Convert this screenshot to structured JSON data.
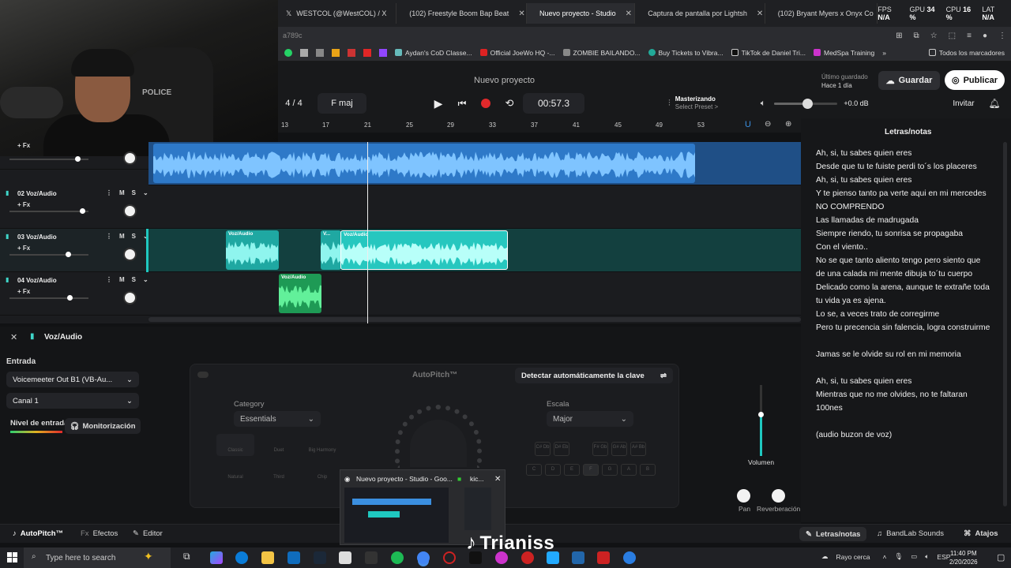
{
  "browser": {
    "tabs": [
      {
        "label": "WESTCOL (@WestCOL) / X",
        "icon": "x-icon"
      },
      {
        "label": "(102) Freestyle Boom Bap Beat",
        "icon": "youtube-icon"
      },
      {
        "label": "Nuevo proyecto - Studio",
        "icon": "bandlab-icon",
        "active": true
      },
      {
        "label": "Captura de pantalla por Lightsh",
        "icon": "feather-icon"
      },
      {
        "label": "(102) Bryant Myers x Onyx Co",
        "icon": "youtube-icon"
      }
    ],
    "stats": {
      "fps_label": "FPS",
      "fps": "N/A",
      "gpu_label": "GPU",
      "gpu": "34 %",
      "cpu_label": "CPU",
      "cpu": "16 %",
      "lat_label": "LAT",
      "lat": "N/A"
    },
    "url_fragment": "a789c",
    "bookmarks": [
      "Aydan's CoD Classe...",
      "Official JoeWo HQ -...",
      "ZOMBIE BAILANDO...",
      "Buy Tickets to Vibra...",
      "TikTok de Daniel Tri...",
      "MedSpa Training"
    ],
    "bookmarks_all": "Todos los marcadores"
  },
  "webcam": {
    "chair_text": "POLICE"
  },
  "header": {
    "project_title": "Nuevo proyecto",
    "saved_label": "Último guardado",
    "saved_time": "Hace 1 día",
    "save_button": "Guardar",
    "publish_button": "Publicar"
  },
  "transport": {
    "time_sig": "4 / 4",
    "key": "F maj",
    "time": "00:57.3",
    "master_label": "Masterizando",
    "master_preset": "Select Preset >",
    "volume_db": "+0.0 dB",
    "invite": "Invitar"
  },
  "ruler": [
    "13",
    "17",
    "21",
    "25",
    "29",
    "33",
    "37",
    "41",
    "45",
    "49",
    "53"
  ],
  "tracks": [
    {
      "name": "",
      "fx": "+ Fx",
      "volume": 0.85
    },
    {
      "name": "02  Voz/Audio",
      "fx": "+ Fx",
      "volume": 0.92
    },
    {
      "name": "03  Voz/Audio",
      "fx": "+ Fx",
      "volume": 0.75
    },
    {
      "name": "04  Voz/Audio",
      "fx": "+ Fx",
      "volume": 0.76
    }
  ],
  "track_buttons": {
    "mute": "M",
    "solo": "S"
  },
  "clips": [
    {
      "label": "Voz/Audio"
    },
    {
      "label": "V..."
    },
    {
      "label": "Voz/Audio"
    },
    {
      "label": "Voz/Audio"
    }
  ],
  "lyrics_panel": {
    "title": "Letras/notas",
    "lines": [
      "Ah, si, tu sabes quien eres",
      "Desde que tu te fuiste perdi to´s los placeres",
      "Ah, si, tu sabes quien eres",
      "Y te pienso tanto pa verte aqui en mi mercedes",
      "NO COMPRENDO",
      "Las llamadas de madrugada",
      "Siempre riendo, tu sonrisa se propagaba",
      "Con el viento..",
      "No se que tanto aliento tengo pero siento que de una calada mi mente dibuja to´tu cuerpo",
      "Delicado como la arena, aunque te extrañe toda tu vida ya es ajena.",
      "Lo se, a veces trato de corregirme",
      "Pero tu precencia sin falencia, logra construirme",
      "",
      "Jamas se le olvide su rol en mi memoria",
      "",
      "Ah, si, tu sabes quien eres",
      "Mientras que no me olvides, no te faltaran 100nes",
      "",
      "(audio buzon de voz)"
    ]
  },
  "bottom_panel": {
    "track_title": "Voz/Audio",
    "entrada_label": "Entrada",
    "input_device": "Voicemeeter Out B1 (VB-Au...",
    "channel": "Canal 1",
    "nivel_label": "Nivel de entrada",
    "monitor_button": "Monitorización",
    "autopitch_title": "AutoPitch™",
    "detect_button": "Detectar automáticamente la clave",
    "category_label": "Category",
    "category_value": "Essentials",
    "scale_label": "Escala",
    "scale_value": "Major",
    "modes": [
      "Classic",
      "Duet",
      "Big Harmony",
      "Natural",
      "Third",
      "Chip"
    ],
    "keys": [
      "C",
      "D",
      "E",
      "F",
      "G",
      "A",
      "B"
    ],
    "sharps": [
      "C#\nDb",
      "D#\nEb",
      "F#\nGb",
      "G#\nAb",
      "A#\nBb"
    ],
    "volume_label": "Volumen",
    "pan_label": "Pan",
    "reverb_label": "Reverberación"
  },
  "appbar": {
    "autopitch": "AutoPitch™",
    "effects": "Efectos",
    "editor": "Editor",
    "lyrics": "Letras/notas",
    "sounds": "BandLab Sounds",
    "shortcuts": "Atajos"
  },
  "taskbar": {
    "search_placeholder": "Type here to search",
    "weather": "Rayo cerca",
    "lang": "ESP",
    "time": "11:40 PM",
    "date": "2/20/2026",
    "thumb1": "Nuevo proyecto - Studio - Goo...",
    "thumb2": "kic..."
  },
  "overlay": {
    "tiktok_name": "Trianiss"
  },
  "colors": {
    "accent_teal": "#1fc8c0",
    "lane_blue": "#3b8fe0",
    "record_red": "#e0292b",
    "clip_green": "#2ecf70"
  }
}
